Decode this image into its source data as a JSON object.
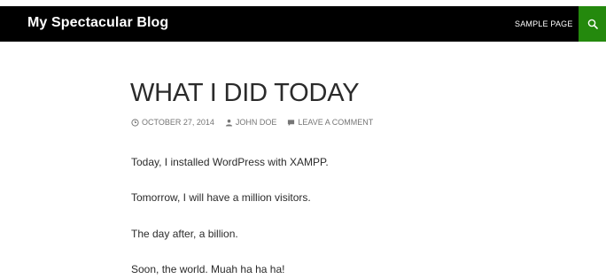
{
  "header": {
    "site_title": "My Spectacular Blog",
    "nav": [
      "SAMPLE PAGE"
    ],
    "search_icon": "search-icon",
    "accent_color": "#24890d"
  },
  "post": {
    "title": "WHAT I DID TODAY",
    "meta": {
      "date": "OCTOBER 27, 2014",
      "author": "JOHN DOE",
      "comments": "LEAVE A COMMENT"
    },
    "paragraphs": [
      "Today, I installed WordPress with XAMPP.",
      "Tomorrow, I will have a million visitors.",
      "The day after, a billion.",
      "Soon, the world. Muah ha ha ha!"
    ]
  }
}
